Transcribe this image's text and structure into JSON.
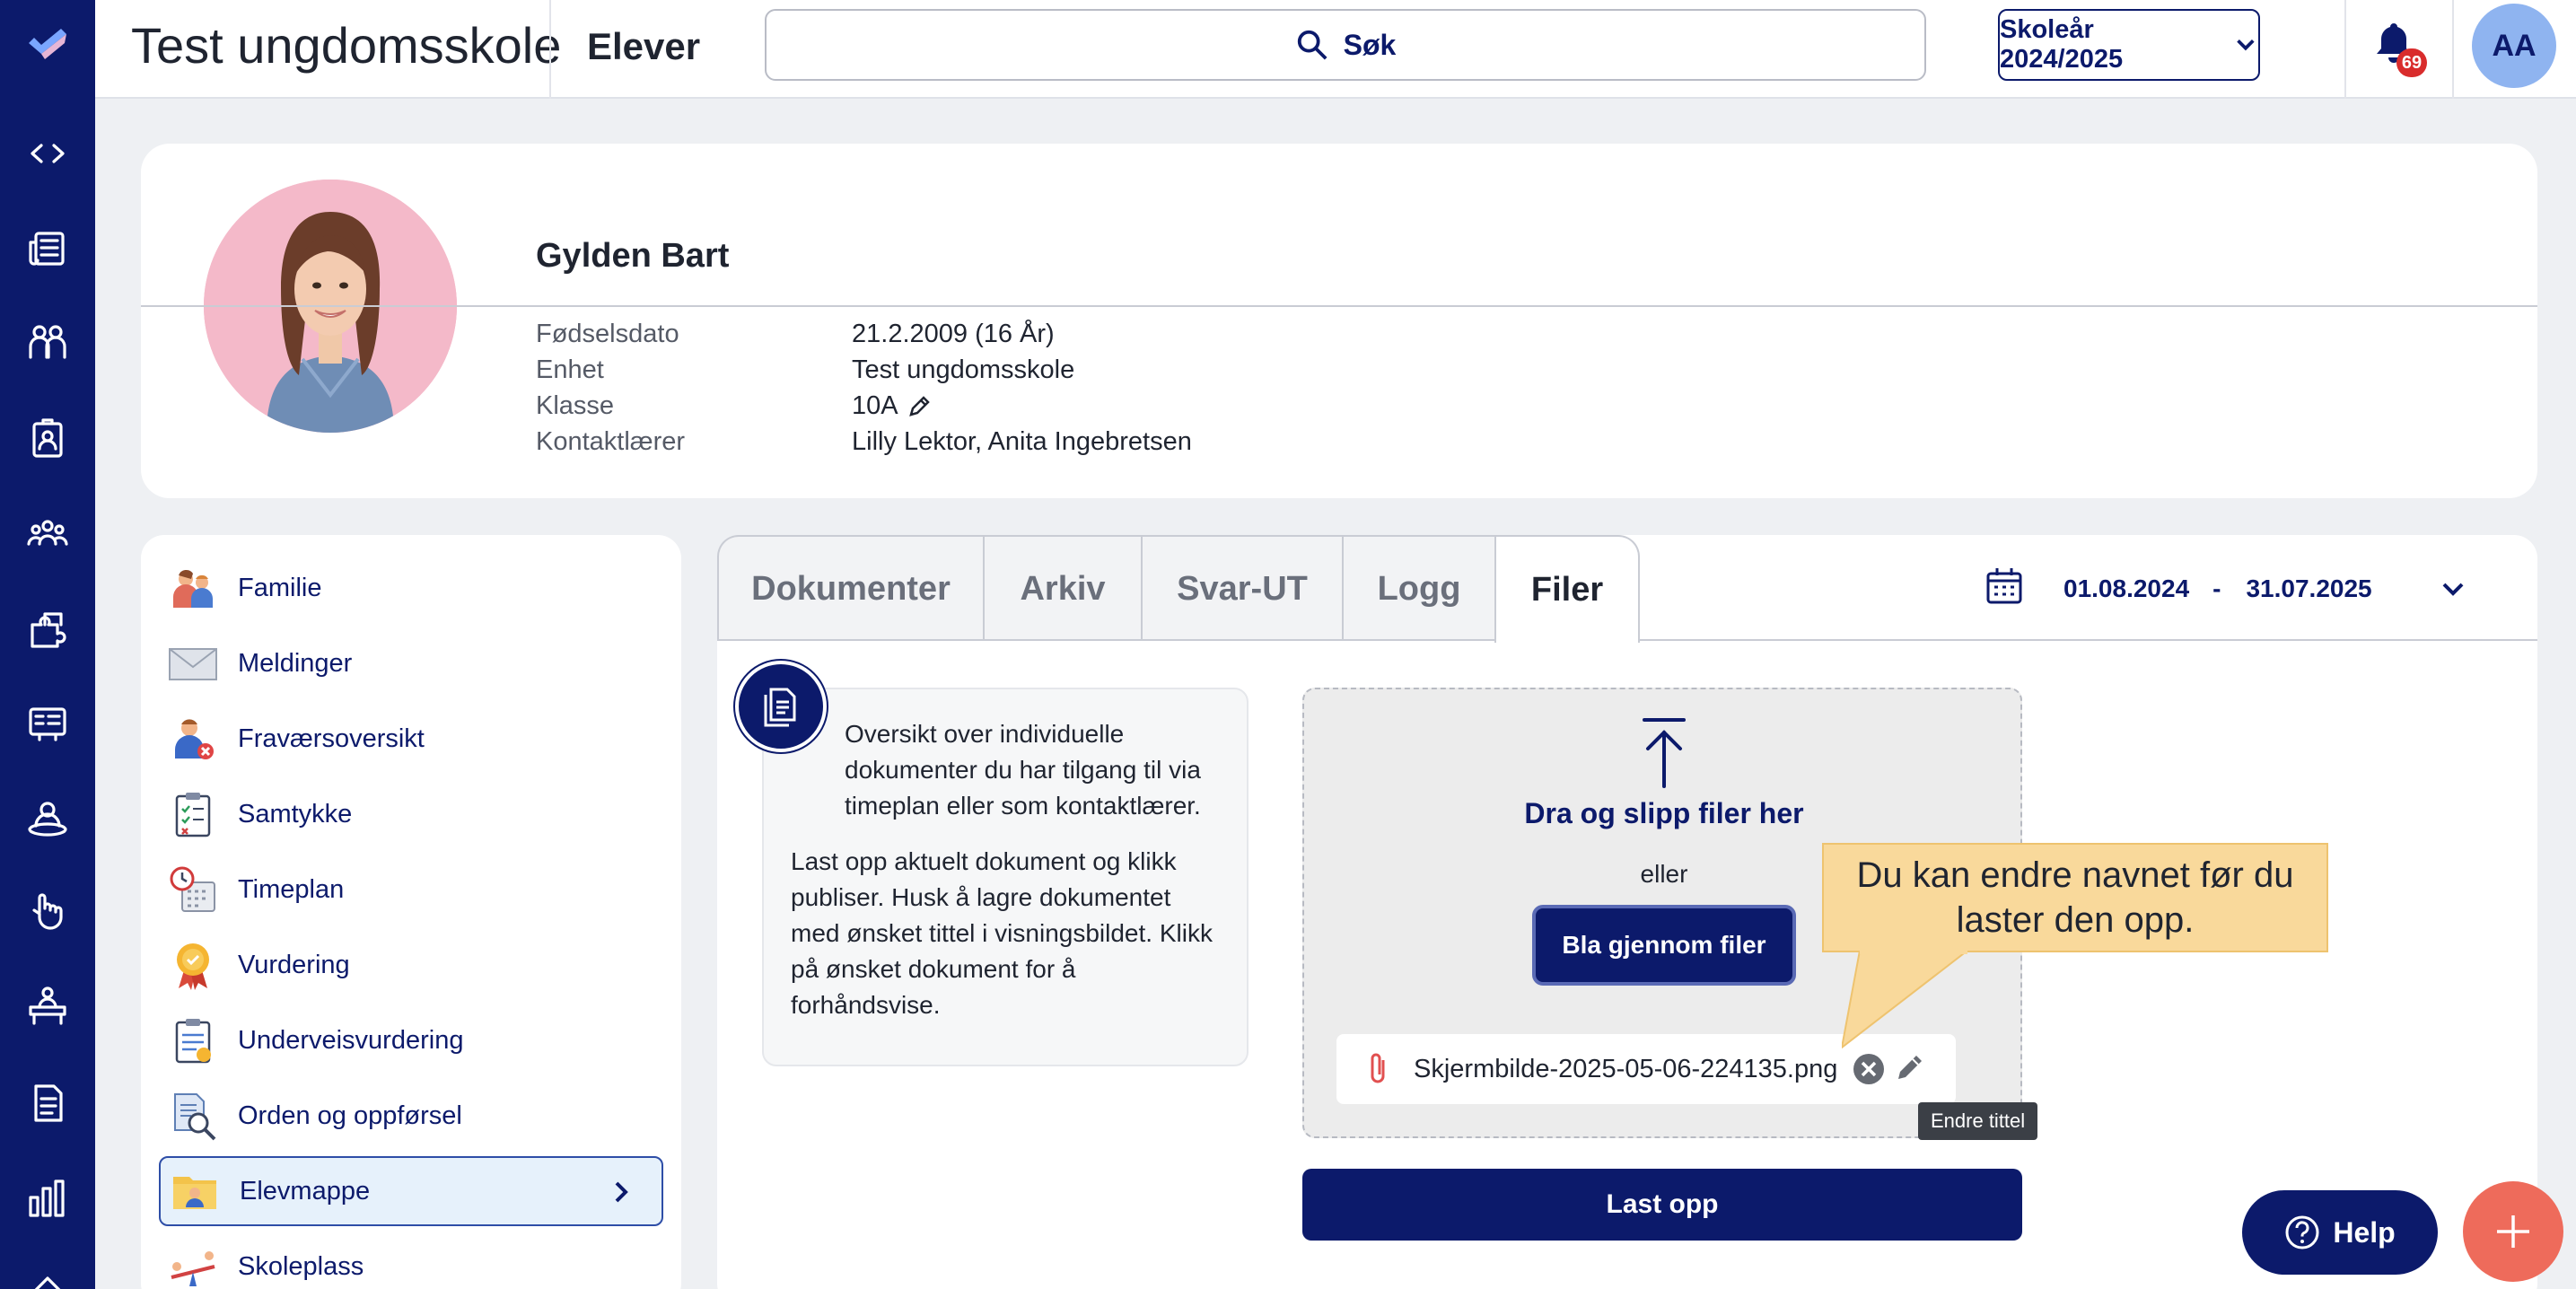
{
  "topbar": {
    "school_name": "Test ungdomsskole",
    "page_name": "Elever",
    "search_label": "Søk",
    "school_year_label": "Skoleår 2024/2025",
    "notification_count": "69",
    "user_initials": "AA"
  },
  "rail": {
    "icons": [
      "expand-collapse-icon",
      "newspaper-icon",
      "people-icon",
      "badge-icon",
      "group-icon",
      "puzzle-icon",
      "grades-icon",
      "person-circle-icon",
      "hand-icon",
      "desk-icon",
      "document-icon",
      "bar-chart-icon"
    ]
  },
  "profile": {
    "name": "Gylden Bart",
    "fields": [
      {
        "label": "Fødselsdato",
        "value": "21.2.2009 (16 År)"
      },
      {
        "label": "Enhet",
        "value": "Test ungdomsskole"
      },
      {
        "label": "Klasse",
        "value": "10A"
      },
      {
        "label": "Kontaktlærer",
        "value": "Lilly Lektor, Anita Ingebretsen"
      }
    ]
  },
  "menu": {
    "items": [
      {
        "label": "Familie",
        "icon": "family-icon"
      },
      {
        "label": "Meldinger",
        "icon": "envelope-icon"
      },
      {
        "label": "Fraværsoversikt",
        "icon": "absence-icon"
      },
      {
        "label": "Samtykke",
        "icon": "clipboard-check-icon"
      },
      {
        "label": "Timeplan",
        "icon": "schedule-icon"
      },
      {
        "label": "Vurdering",
        "icon": "medal-icon"
      },
      {
        "label": "Underveisvurdering",
        "icon": "clipboard-icon"
      },
      {
        "label": "Orden og oppførsel",
        "icon": "magnifier-doc-icon"
      },
      {
        "label": "Elevmappe",
        "icon": "student-folder-icon"
      },
      {
        "label": "Skoleplass",
        "icon": "seesaw-icon"
      }
    ]
  },
  "tabs": [
    "Dokumenter",
    "Arkiv",
    "Svar-UT",
    "Logg",
    "Filer"
  ],
  "date_range": {
    "from": "01.08.2024",
    "separator": "-",
    "to": "31.07.2025"
  },
  "info": {
    "paragraph1": "Oversikt over individuelle dokumenter du har tilgang til via timeplan eller som kontaktlærer.",
    "paragraph2": "Last opp aktuelt dokument og klikk publiser. Husk å lagre dokumentet med ønsket tittel i visningsbildet. Klikk på ønsket dokument for å forhåndsvise."
  },
  "dropzone": {
    "title": "Dra og slipp filer her",
    "or": "eller",
    "browse": "Bla gjennom filer",
    "file_name": "Skjermbilde-2025-05-06-224135.png",
    "tooltip": "Endre tittel",
    "callout": "Du kan endre navnet før du laster den opp."
  },
  "upload_label": "Last opp",
  "help_label": "Help",
  "colors": {
    "brand": "#0c1a6b",
    "accent": "#ee6b5b",
    "callout": "#f9d99b"
  }
}
